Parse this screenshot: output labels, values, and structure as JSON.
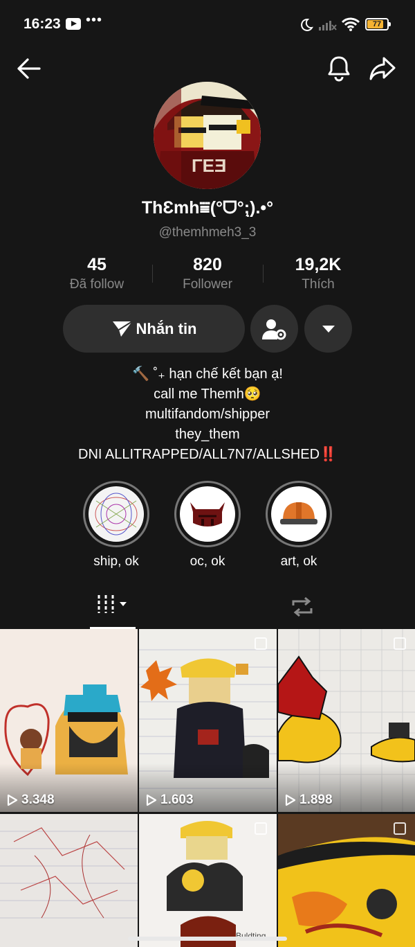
{
  "status_bar": {
    "time": "16:23",
    "dots": "•••",
    "battery_level": "77",
    "battery_fraction": 0.77
  },
  "nav": {
    "back_icon": "arrow-left-icon",
    "bell_icon": "bell-icon",
    "share_icon": "share-icon"
  },
  "profile": {
    "display_name": "ThƐmh⩸(°ᗜ°;̤).•°",
    "username": "@themhmeh3_3"
  },
  "stats": [
    {
      "value": "45",
      "label": "Đã follow"
    },
    {
      "value": "820",
      "label": "Follower"
    },
    {
      "value": "19,2K",
      "label": "Thích"
    }
  ],
  "actions": {
    "message_label": "Nhắn tin"
  },
  "bio": [
    "🔨 ˚₊ hạn chế kết bạn ạ!",
    "call me Themh🥺",
    "multifandom/shipper",
    "they_them",
    "DNI ALLITRAPPED/ALL7N7/ALLSHED‼️"
  ],
  "highlights": [
    {
      "label": "ship, ok"
    },
    {
      "label": "oc, ok"
    },
    {
      "label": "art, ok"
    }
  ],
  "videos": [
    {
      "views": "3.348"
    },
    {
      "views": "1.603"
    },
    {
      "views": "1.898"
    }
  ],
  "colors": {
    "background": "#161616",
    "button": "#2f2f2f",
    "muted_text": "#8a8a8a",
    "battery": "#f5b333",
    "alert": "#e53935"
  }
}
